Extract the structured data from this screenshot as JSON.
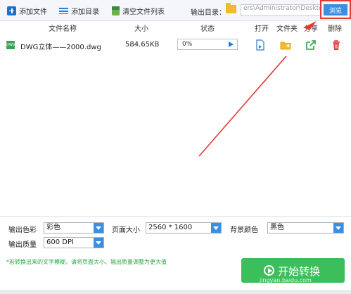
{
  "toolbar": {
    "add_file": "添加文件",
    "add_dir": "添加目录",
    "clear_list": "清空文件列表",
    "output_dir_label": "输出目录：",
    "output_dir_value": "ers\\Administrator\\Desktop",
    "browse": "浏览"
  },
  "table": {
    "headers": {
      "name": "文件名称",
      "size": "大小",
      "status": "状态",
      "open": "打开",
      "folder": "文件夹",
      "share": "分享",
      "delete": "删除"
    },
    "rows": [
      {
        "icon": "DWG",
        "name": "DWG立体——2000.dwg",
        "size": "584.65KB",
        "progress_text": "0%",
        "progress": 0
      }
    ]
  },
  "options": {
    "color_label": "输出色彩",
    "color_value": "彩色",
    "page_size_label": "页面大小",
    "page_size_value": "2560 * 1600",
    "bg_color_label": "背景颜色",
    "bg_color_value": "黑色",
    "quality_label": "输出质量",
    "quality_value": "600 DPI"
  },
  "note": "*若转换出来的文字模糊，请将页面大小、输出质量调整为更大值",
  "start_button": "开始转换",
  "watermark": "jingyan.baidu.com",
  "colors": {
    "accent": "#3b8fe0",
    "start_green": "#3cbf5a",
    "note_green": "#27a745",
    "highlight_red": "#e53935"
  }
}
